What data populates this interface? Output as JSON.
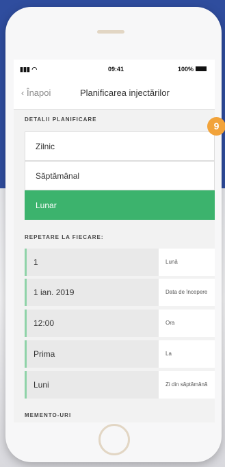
{
  "status_bar": {
    "time": "09:41",
    "battery": "100%"
  },
  "nav": {
    "back_label": "Înapoi",
    "title": "Planificarea injectărilor"
  },
  "planning": {
    "header": "DETALII PLANIFICARE",
    "options": [
      {
        "label": "Zilnic",
        "selected": false
      },
      {
        "label": "Săptămânal",
        "selected": false
      },
      {
        "label": "Lunar",
        "selected": true
      }
    ]
  },
  "repeat": {
    "header": "REPETARE LA FIECARE:",
    "rows": [
      {
        "value": "1",
        "label": "Lună"
      },
      {
        "value": "1 ian. 2019",
        "label": "Data de începere"
      },
      {
        "value": "12:00",
        "label": "Ora"
      },
      {
        "value": "Prima",
        "label": "La"
      },
      {
        "value": "Luni",
        "label": "Zi din săptămână"
      }
    ]
  },
  "reminders": {
    "header": "MEMENTO-URI"
  },
  "badge": "9",
  "colors": {
    "selected": "#3cb36d",
    "accent_bar": "#8fd3a8",
    "badge": "#f2a33a",
    "background": "#2f4d9e"
  }
}
